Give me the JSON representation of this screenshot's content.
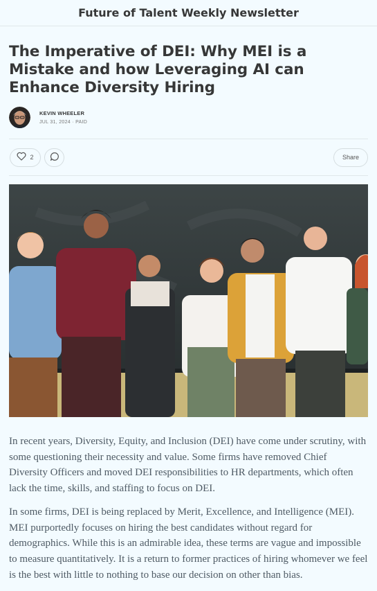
{
  "newsletter": {
    "title": "Future of Talent Weekly Newsletter"
  },
  "post": {
    "title": "The Imperative of DEI: Why MEI is a Mistake and how Leveraging AI can Enhance Diversity Hiring",
    "author": "KEVIN WHEELER",
    "date": "JUL 31, 2024 · PAID"
  },
  "actions": {
    "like_count": "2",
    "share_label": "Share"
  },
  "icons": {
    "like": "heart-icon",
    "comment": "comment-icon"
  },
  "colors": {
    "background": "#f3fbff",
    "text": "#363737",
    "body_text": "#4e5a64",
    "border": "#dfe7ea"
  },
  "body": {
    "paragraphs": [
      "In recent years, Diversity, Equity, and Inclusion (DEI) have come under scrutiny, with some questioning their necessity and value. Some firms have removed Chief Diversity Officers and moved DEI responsibilities to HR departments, which often lack the time, skills, and staffing to focus on DEI.",
      "In some firms, DEI is being replaced by Merit, Excellence, and Intelligence (MEI). MEI purportedly focuses on hiring the best candidates without regard for demographics. While this is an admirable idea, these terms are vague and impossible to measure quantitatively. It is a return to former practices of hiring whomever we feel is the best with little to nothing to base our decision on other than bias."
    ]
  }
}
